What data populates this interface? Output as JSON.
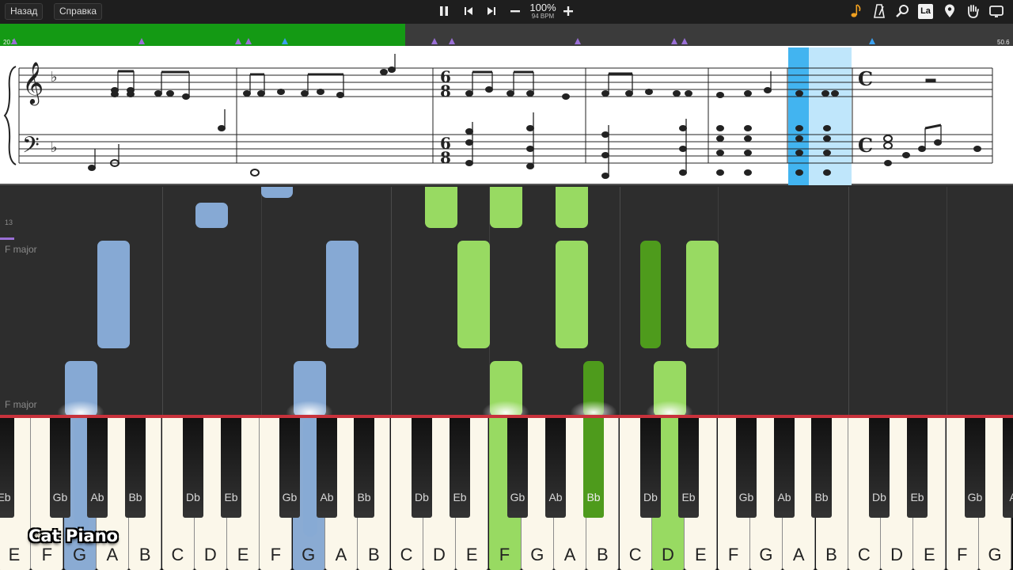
{
  "toolbar": {
    "back_label": "Назад",
    "help_label": "Справка",
    "zoom": "100%",
    "bpm": "94 BPM",
    "icons": [
      "pause-icon",
      "skip-back-icon",
      "skip-forward-icon",
      "minus-icon",
      "plus-icon",
      "note-icon",
      "metronome-icon",
      "search-icon",
      "la-icon",
      "location-pin-icon",
      "hand-icon",
      "display-icon"
    ],
    "la_label": "La"
  },
  "progress": {
    "fraction": 0.4,
    "start_label": "20.3",
    "end_label": "50.6",
    "colors": {
      "fill": "#149a14",
      "track": "#3b3b3b",
      "marker_purple": "#9a6fd6",
      "marker_blue": "#3aa0f0"
    }
  },
  "roll": {
    "measure_number": "13",
    "key_label_upper": "F major",
    "key_label_lower": "F major",
    "colors": {
      "left_hand": "#86a9d4",
      "right_hand": "#98da62",
      "right_hand_dark": "#4e9b1c"
    }
  },
  "keyboard": {
    "white_keys": [
      "E",
      "F",
      "G",
      "A",
      "B",
      "C",
      "D",
      "E",
      "F",
      "G",
      "A",
      "B",
      "C",
      "D",
      "E",
      "F",
      "G",
      "A",
      "B",
      "C",
      "D",
      "E",
      "F",
      "G",
      "A",
      "B",
      "C",
      "D",
      "E",
      "F",
      "G"
    ],
    "black_keys": [
      "Eb",
      "Gb",
      "Ab",
      "Bb",
      "Db",
      "Eb",
      "Gb",
      "Ab",
      "Bb",
      "Db",
      "Eb",
      "Gb",
      "Ab",
      "Bb",
      "Db",
      "Eb",
      "Gb",
      "Ab",
      "Bb",
      "Db",
      "Eb",
      "Gb",
      "A"
    ],
    "active_left": [
      "G",
      "G"
    ],
    "active_right": [
      "F",
      "D",
      "Bb"
    ]
  },
  "watermark": "Cat Piano"
}
